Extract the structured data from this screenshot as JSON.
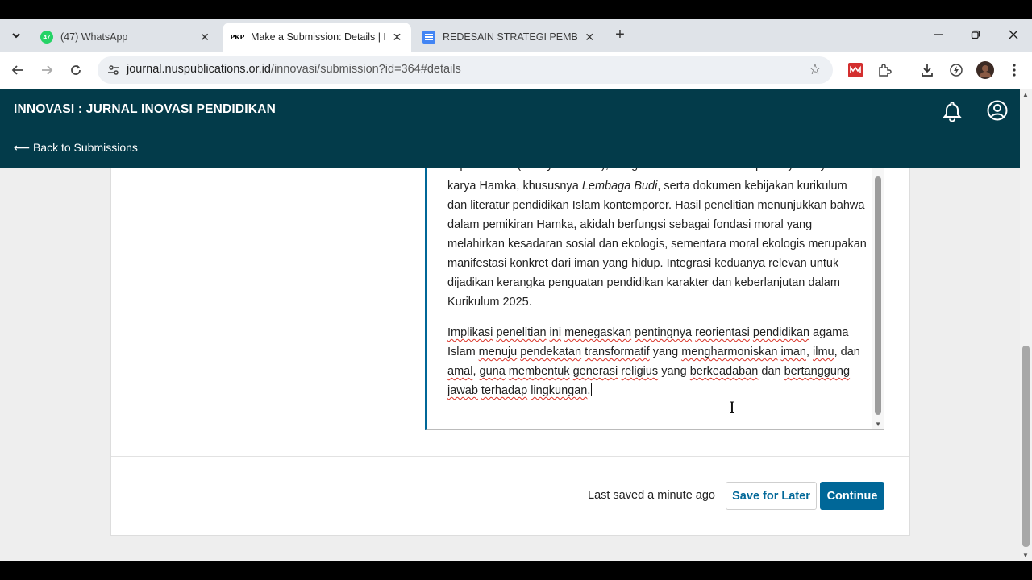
{
  "browser": {
    "tabs": [
      {
        "title": "(47) WhatsApp",
        "badge": "47",
        "active": false
      },
      {
        "title": "Make a Submission: Details | IN",
        "favicon_text": "PKP",
        "active": true
      },
      {
        "title": "REDESAIN STRATEGI PEMBELAJ",
        "active": false
      }
    ],
    "url_host": "journal.nuspublications.or.id",
    "url_path": "/innovasi/submission?id=364#details"
  },
  "header": {
    "journal_title": "INNOVASI : JURNAL INOVASI PENDIDIKAN",
    "back_link": "⟵ Back to Submissions"
  },
  "editor": {
    "partial_line": "kepustakaan (library research), dengan sumber utama berupa karya-karya",
    "p1_a": "karya Hamka, khususnya ",
    "p1_em": "Lembaga Budi",
    "p1_b": ", serta dokumen kebijakan kurikulum dan literatur pendidikan Islam kontemporer. Hasil penelitian menunjukkan bahwa dalam pemikiran Hamka, akidah berfungsi sebagai fondasi moral yang melahirkan kesadaran sosial dan ekologis, sementara moral ekologis merupakan manifestasi konkret dari iman yang hidup. Integrasi keduanya relevan untuk dijadikan kerangka penguatan pendidikan karakter dan keberlanjutan dalam Kurikulum 2025.",
    "p2": [
      {
        "t": "Implikasi",
        "s": true
      },
      {
        "t": " "
      },
      {
        "t": "penelitian",
        "s": true
      },
      {
        "t": " "
      },
      {
        "t": "ini",
        "s": true
      },
      {
        "t": " "
      },
      {
        "t": "menegaskan",
        "s": true
      },
      {
        "t": " "
      },
      {
        "t": "pentingnya",
        "s": true
      },
      {
        "t": " "
      },
      {
        "t": "reorientasi",
        "s": true
      },
      {
        "t": " "
      },
      {
        "t": "pendidikan",
        "s": true
      },
      {
        "t": " agama Islam "
      },
      {
        "t": "menuju",
        "s": true
      },
      {
        "t": " "
      },
      {
        "t": "pendekatan",
        "s": true
      },
      {
        "t": " "
      },
      {
        "t": "transformatif",
        "s": true
      },
      {
        "t": " yang "
      },
      {
        "t": "mengharmoniskan",
        "s": true
      },
      {
        "t": " "
      },
      {
        "t": "iman",
        "s": true
      },
      {
        "t": ", "
      },
      {
        "t": "ilmu",
        "s": true
      },
      {
        "t": ", dan "
      },
      {
        "t": "amal",
        "s": true
      },
      {
        "t": ", "
      },
      {
        "t": "guna",
        "s": true
      },
      {
        "t": " "
      },
      {
        "t": "membentuk",
        "s": true
      },
      {
        "t": " "
      },
      {
        "t": "generasi",
        "s": true
      },
      {
        "t": " "
      },
      {
        "t": "religius",
        "s": true
      },
      {
        "t": " yang "
      },
      {
        "t": "berkeadaban",
        "s": true
      },
      {
        "t": " dan "
      },
      {
        "t": "bertanggung",
        "s": true
      },
      {
        "t": " "
      },
      {
        "t": "jawab",
        "s": true
      },
      {
        "t": " "
      },
      {
        "t": "terhadap",
        "s": true
      },
      {
        "t": " "
      },
      {
        "t": "lingkungan",
        "s": true
      },
      {
        "t": "."
      }
    ]
  },
  "footer": {
    "last_saved": "Last saved a minute ago",
    "save_later": "Save for Later",
    "continue": "Continue"
  },
  "colors": {
    "header_bg": "#033b4a",
    "primary": "#006798"
  }
}
